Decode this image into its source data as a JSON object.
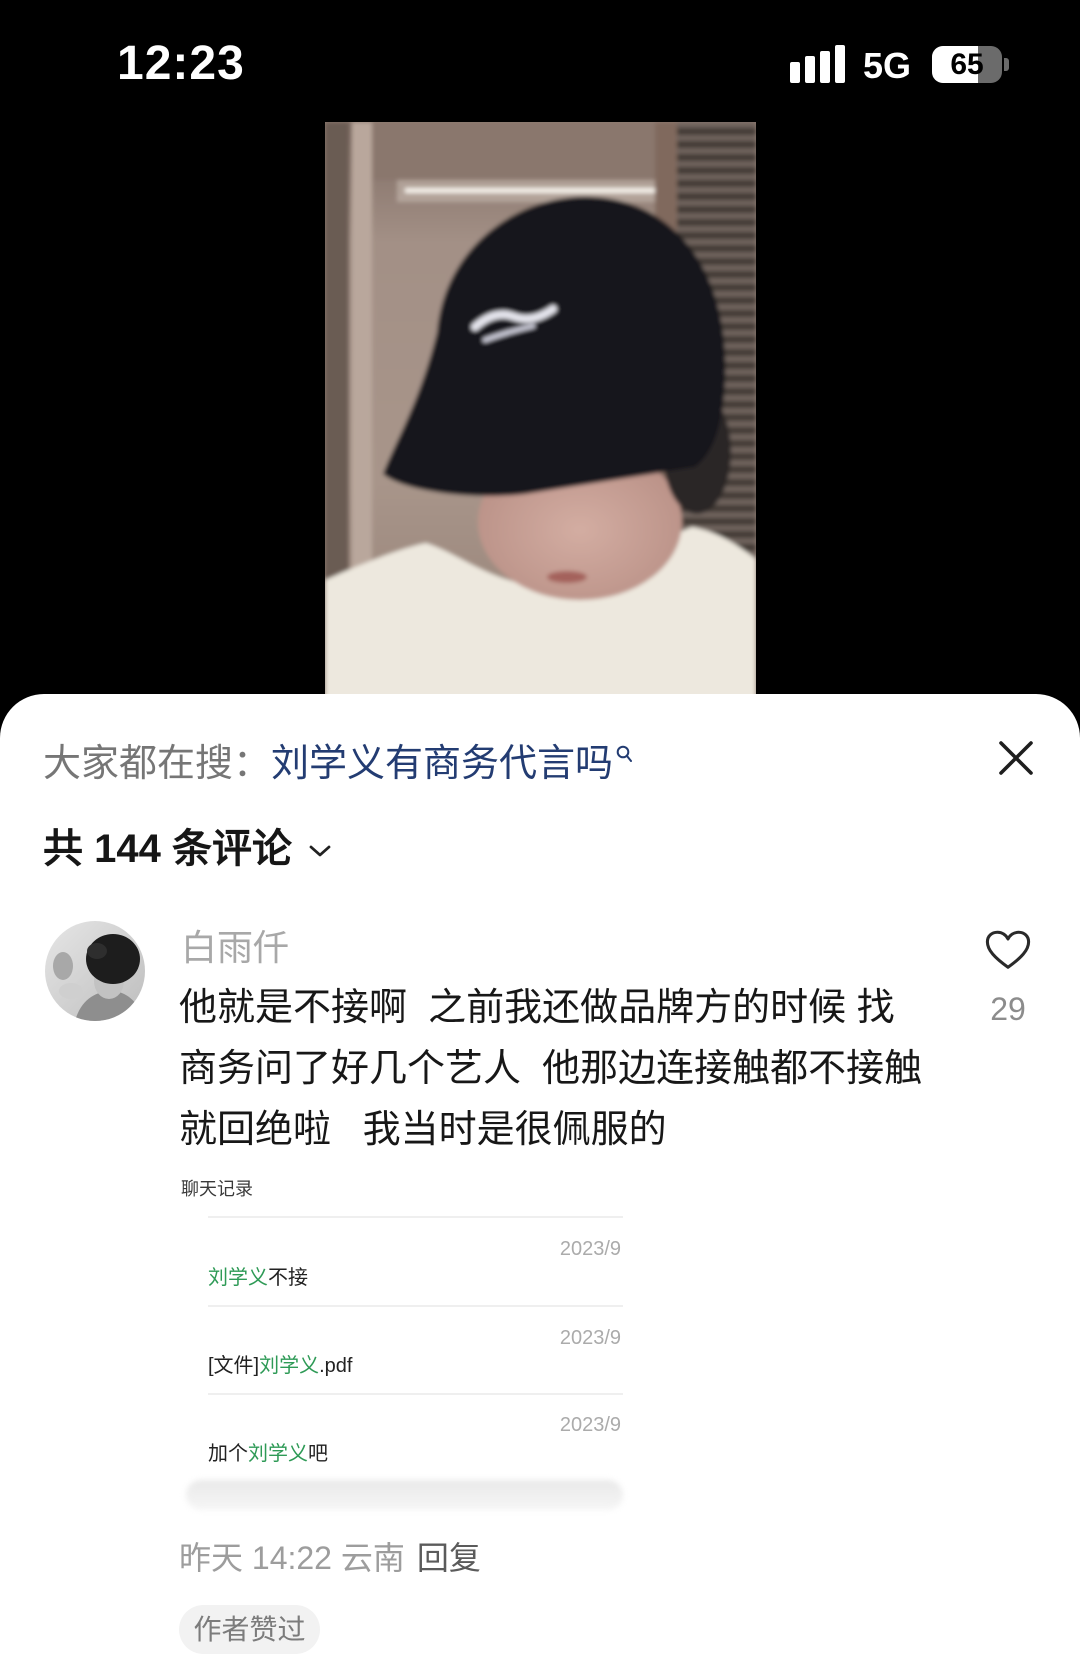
{
  "status_bar": {
    "time": "12:23",
    "network": "5G",
    "battery_percent": "65",
    "battery_level": 0.65,
    "icons": {
      "signal": "cellular-signal-icon",
      "battery": "battery-icon"
    }
  },
  "search_bar": {
    "prefix": "大家都在搜：",
    "query": "刘学义有商务代言吗",
    "query_color": "#233c72",
    "icon": "search-icon"
  },
  "header": {
    "comment_count_label": "共 144 条评论",
    "dropdown_icon": "chevron-down-icon",
    "close_icon": "close-icon"
  },
  "comment": {
    "username": "白雨仟",
    "text_lines": [
      "他就是不接啊  之前我还做品牌方的时候 找",
      "商务问了好几个艺人  他那边连接触都不接触",
      "就回绝啦   我当时是很佩服的"
    ],
    "like_icon": "heart-icon",
    "like_count": "29",
    "image_attachment": {
      "title": "聊天记录",
      "highlight_color": "#2e9a56",
      "messages": [
        {
          "date": "2023/9",
          "parts": [
            {
              "text": "刘学义",
              "highlight": true
            },
            {
              "text": "不接",
              "highlight": false
            }
          ]
        },
        {
          "date": "2023/9",
          "parts": [
            {
              "text": "[文件]",
              "highlight": false
            },
            {
              "text": "刘学义",
              "highlight": true
            },
            {
              "text": ".pdf",
              "highlight": false
            }
          ]
        },
        {
          "date": "2023/9",
          "parts": [
            {
              "text": "加个",
              "highlight": false
            },
            {
              "text": "刘学义",
              "highlight": true
            },
            {
              "text": "吧",
              "highlight": false
            }
          ]
        }
      ]
    },
    "meta": "昨天 14:22 云南",
    "reply_label": "回复",
    "author_liked_badge": "作者赞过"
  }
}
